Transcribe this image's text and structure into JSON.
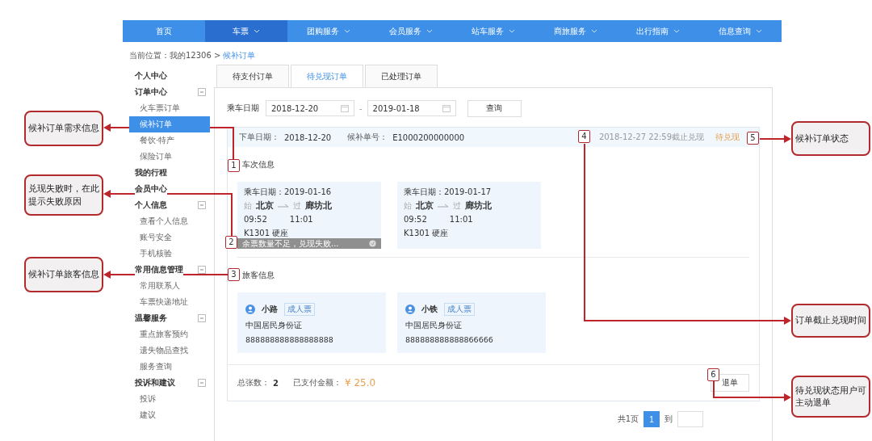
{
  "nav": [
    {
      "label": "首页",
      "selected": false,
      "has_menu": false
    },
    {
      "label": "车票",
      "selected": true,
      "has_menu": true
    },
    {
      "label": "团购服务",
      "selected": false,
      "has_menu": true
    },
    {
      "label": "会员服务",
      "selected": false,
      "has_menu": true
    },
    {
      "label": "站车服务",
      "selected": false,
      "has_menu": true
    },
    {
      "label": "商旅服务",
      "selected": false,
      "has_menu": true
    },
    {
      "label": "出行指南",
      "selected": false,
      "has_menu": true
    },
    {
      "label": "信息查询",
      "selected": false,
      "has_menu": true
    }
  ],
  "breadcrumb": {
    "prefix": "当前位置：我的12306 >",
    "current": "候补订单"
  },
  "sidebar": [
    {
      "title": "个人中心"
    },
    {
      "title": "订单中心",
      "children": [
        {
          "label": "火车票订单",
          "selected": false
        },
        {
          "label": "候补订单",
          "selected": true
        },
        {
          "label": "餐饮·特产",
          "selected": false
        },
        {
          "label": "保险订单",
          "selected": false
        }
      ]
    },
    {
      "title": "我的行程"
    },
    {
      "title": "会员中心"
    },
    {
      "title": "个人信息",
      "children": [
        {
          "label": "查看个人信息",
          "selected": false
        },
        {
          "label": "账号安全",
          "selected": false
        },
        {
          "label": "手机核验",
          "selected": false
        }
      ]
    },
    {
      "title": "常用信息管理",
      "children": [
        {
          "label": "常用联系人",
          "selected": false
        },
        {
          "label": "车票快递地址",
          "selected": false
        }
      ]
    },
    {
      "title": "温馨服务",
      "children": [
        {
          "label": "重点旅客预约",
          "selected": false
        },
        {
          "label": "遗失物品查找",
          "selected": false
        },
        {
          "label": "服务查询",
          "selected": false
        }
      ]
    },
    {
      "title": "投诉和建议",
      "children": [
        {
          "label": "投诉",
          "selected": false
        },
        {
          "label": "建议",
          "selected": false
        }
      ]
    }
  ],
  "tabs": [
    {
      "label": "待支付订单",
      "selected": false
    },
    {
      "label": "待兑现订单",
      "selected": true
    },
    {
      "label": "已处理订单",
      "selected": false
    }
  ],
  "filter": {
    "label": "乘车日期",
    "date_from": "2018-12-20",
    "separator": "-",
    "date_to": "2019-01-18",
    "button": "查询"
  },
  "order": {
    "order_date_label": "下单日期：",
    "order_date": "2018-12-20",
    "order_no_label": "候补单号：",
    "order_no": "E1000200000000",
    "deadline": "2018-12-27 22:59截止兑现",
    "status": "待兑现",
    "trains_title": "车次信息",
    "trains": [
      {
        "date": "乘车日期：2019-01-16",
        "from_tag": "始",
        "from": "北京",
        "to_tag": "过",
        "to": "廊坊北",
        "depart": "09:52",
        "arrive": "11:01",
        "train": "K1301 硬座",
        "failure": "余票数量不足，兑现失败..."
      },
      {
        "date": "乘车日期：2019-01-17",
        "from_tag": "始",
        "from": "北京",
        "to_tag": "过",
        "to": "廊坊北",
        "depart": "09:52",
        "arrive": "11:01",
        "train": "K1301 硬座"
      }
    ],
    "passengers_title": "旅客信息",
    "passengers": [
      {
        "name": "小路",
        "ticket_type": "成人票",
        "id_type": "中国居民身份证",
        "id_number": "888888888888888888"
      },
      {
        "name": "小铁",
        "ticket_type": "成人票",
        "id_type": "中国居民身份证",
        "id_number": "888888888888866666"
      }
    ],
    "count_label": "总张数：",
    "count": "2",
    "paid_label": "已支付金额：",
    "paid": "¥ 25.0",
    "refund_button": "退单"
  },
  "pagination": {
    "total": "共1页",
    "pages": [
      {
        "label": "1",
        "selected": true
      }
    ],
    "goto_label": "到"
  },
  "annotations": [
    {
      "number": "1",
      "note": "候补订单需求信息"
    },
    {
      "number": "2",
      "note": "兑现失败时，在此提示失败原因"
    },
    {
      "number": "3",
      "note": "候补订单旅客信息"
    },
    {
      "number": "5",
      "note": "候补订单状态"
    },
    {
      "number": "4",
      "note": "订单截止兑现时间"
    },
    {
      "number": "6",
      "note": "待兑现状态用户可主动退单"
    }
  ]
}
